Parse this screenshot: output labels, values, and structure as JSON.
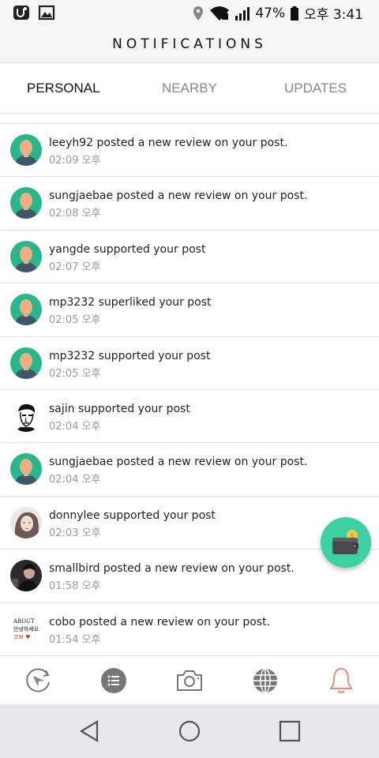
{
  "status_bar": {
    "battery": "47%",
    "time": "오후 3:41",
    "icons": [
      "u-plus-icon",
      "gallery-icon",
      "location-icon",
      "wifi-icon",
      "signal-icon",
      "battery-icon"
    ]
  },
  "header": {
    "title": "NOTIFICATIONS"
  },
  "tabs": [
    {
      "label": "PERSONAL",
      "active": true
    },
    {
      "label": "NEARBY",
      "active": false
    },
    {
      "label": "UPDATES",
      "active": false
    }
  ],
  "notifications": [
    {
      "user": "leeyh92",
      "text": "leeyh92 posted a new review on your post.",
      "time": "02:09 오후",
      "avatar": "default"
    },
    {
      "user": "sungjaebae",
      "text": "sungjaebae posted a new review on your post.",
      "time": "02:08 오후",
      "avatar": "default"
    },
    {
      "user": "yangde",
      "text": "yangde supported your post",
      "time": "02:07 오후",
      "avatar": "default"
    },
    {
      "user": "mp3232",
      "text": "mp3232 superliked your post",
      "time": "02:05 오후",
      "avatar": "default"
    },
    {
      "user": "mp3232",
      "text": "mp3232 supported your post",
      "time": "02:05 오후",
      "avatar": "default"
    },
    {
      "user": "sajin",
      "text": "sajin supported your post",
      "time": "02:04 오후",
      "avatar": "sketch"
    },
    {
      "user": "sungjaebae",
      "text": "sungjaebae posted a new review on your post.",
      "time": "02:04 오후",
      "avatar": "default"
    },
    {
      "user": "donnylee",
      "text": "donnylee supported your post",
      "time": "02:03 오후",
      "avatar": "photo"
    },
    {
      "user": "smallbird",
      "text": "smallbird posted a new review on your post.",
      "time": "01:58 오후",
      "avatar": "photo-dark"
    },
    {
      "user": "cobo",
      "text": "cobo posted a new review on your post.",
      "time": "01:54 오후",
      "avatar": "text-image"
    }
  ],
  "cobo_avatar_text": [
    "ABOUT",
    "안녕하세요",
    "코보 ♥"
  ],
  "fab": {
    "icon": "wallet-icon",
    "color": "#3ecfa3"
  },
  "bottom_nav": [
    {
      "icon": "compass-refresh-icon"
    },
    {
      "icon": "list-icon"
    },
    {
      "icon": "camera-icon"
    },
    {
      "icon": "globe-icon"
    },
    {
      "icon": "bell-icon",
      "active": true,
      "active_color": "#e88b7a"
    }
  ],
  "system_nav": [
    {
      "icon": "back-icon"
    },
    {
      "icon": "home-icon"
    },
    {
      "icon": "recents-icon"
    }
  ],
  "colors": {
    "avatar_bg": "#2bb58a",
    "avatar_body": "#3f5768",
    "avatar_face": "#e9b086"
  }
}
